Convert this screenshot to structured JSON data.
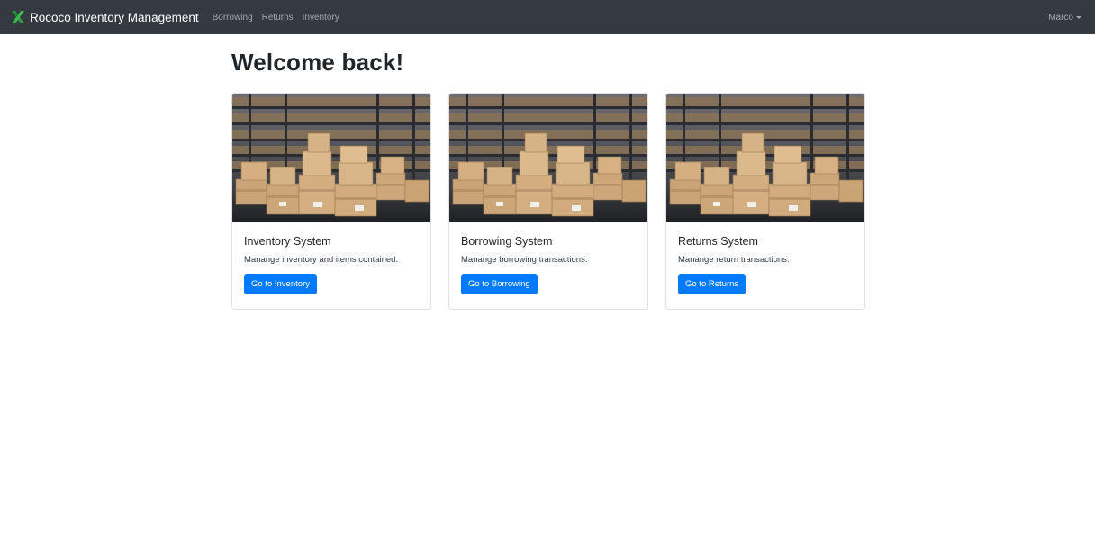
{
  "navbar": {
    "brand": "Rococo Inventory Management",
    "logo_icon": "green-x-logo-icon",
    "brand_color": "#2ea043",
    "links": [
      {
        "label": "Borrowing"
      },
      {
        "label": "Returns"
      },
      {
        "label": "Inventory"
      }
    ],
    "user": "Marco",
    "user_icon": "caret-down-icon"
  },
  "main": {
    "title": "Welcome back!",
    "cards": [
      {
        "title": "Inventory System",
        "text": "Manange inventory and items contained.",
        "button": "Go to Inventory",
        "image": "warehouse-boxes-image"
      },
      {
        "title": "Borrowing System",
        "text": "Manange borrowing transactions.",
        "button": "Go to Borrowing",
        "image": "warehouse-boxes-image"
      },
      {
        "title": "Returns System",
        "text": "Manange return transactions.",
        "button": "Go to Returns",
        "image": "warehouse-boxes-image"
      }
    ]
  },
  "colors": {
    "navbar_bg": "#343a40",
    "primary": "#007bff"
  }
}
